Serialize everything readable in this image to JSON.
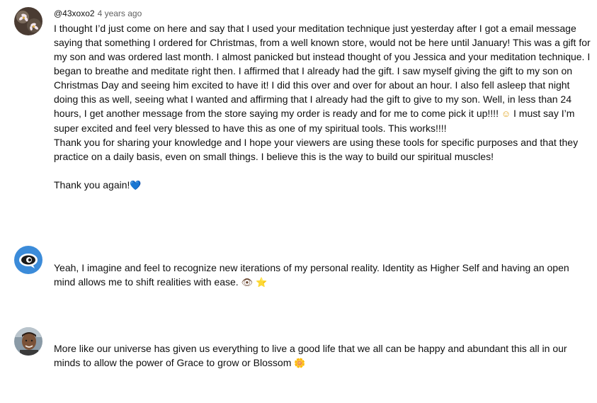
{
  "comments": [
    {
      "author": "@43xoxo2",
      "time": "4 years ago",
      "paragraphs": [
        "I thought I’d just come on here and say that I used your meditation technique just yesterday after I got a email message saying that something I ordered for Christmas, from a well known store, would not be here until January! This was a gift for my son and was ordered last month. I almost panicked but instead thought of you Jessica and your meditation technique. I began to breathe and meditate right then.  I affirmed that I already had the gift. I saw myself giving the gift to my son on Christmas Day and seeing him excited to have it! I did this over and over for about an hour. I also fell asleep that night doing this as well, seeing what I wanted and affirming that I already had the gift to give to my son. Well, in less than 24 hours, I get another message from the store saying my order is ready and for me to come pick it up!!!!",
        "I must say I’m super excited and feel very blessed to have this as one of my spiritual tools. This works!!!!",
        "Thank you for sharing your knowledge and I hope your viewers are using these tools for specific purposes and that they practice on a daily basis, even on small things. I believe this is the way to build our spiritual muscles!",
        "Thank you again!"
      ],
      "emojis": [
        "☺",
        "💙"
      ]
    },
    {
      "author": "",
      "time": "",
      "paragraphs": [
        "Yeah, I imagine and feel to recognize new iterations of my personal reality. Identity as Higher Self and having an open mind allows me to shift realities with ease."
      ],
      "emojis": [
        "👁",
        "⭐"
      ]
    },
    {
      "author": "",
      "time": "",
      "paragraphs": [
        "More like our universe has given us everything to live a good life that we all can be happy and abundant this all in our minds to allow the power of Grace to grow or Blossom"
      ],
      "emojis": [
        "🌼"
      ]
    }
  ],
  "colors": {
    "text": "#0f0f0f",
    "meta": "#606060",
    "avatar2_bg": "#3b8bd9",
    "heart": "#3d9ee8"
  },
  "icons": [
    "avatar-flowers",
    "avatar-ram-emblem",
    "avatar-portrait"
  ]
}
